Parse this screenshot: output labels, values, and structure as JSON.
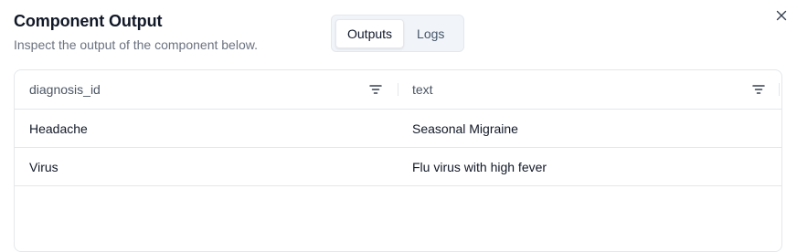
{
  "dialog": {
    "title": "Component Output",
    "subtitle": "Inspect the output of the component below.",
    "close_icon": "close-icon"
  },
  "tabs": [
    {
      "label": "Outputs",
      "active": true
    },
    {
      "label": "Logs",
      "active": false
    }
  ],
  "table": {
    "columns": [
      {
        "label": "diagnosis_id",
        "icon": "filter-icon"
      },
      {
        "label": "text",
        "icon": "filter-icon"
      }
    ],
    "rows": [
      [
        "Headache",
        "Seasonal Migraine"
      ],
      [
        "Virus",
        "Flu virus with high fever"
      ]
    ]
  },
  "colors": {
    "border": "#e5e7eb",
    "muted_text": "#6b7280",
    "tab_bg": "#f1f5f9"
  }
}
